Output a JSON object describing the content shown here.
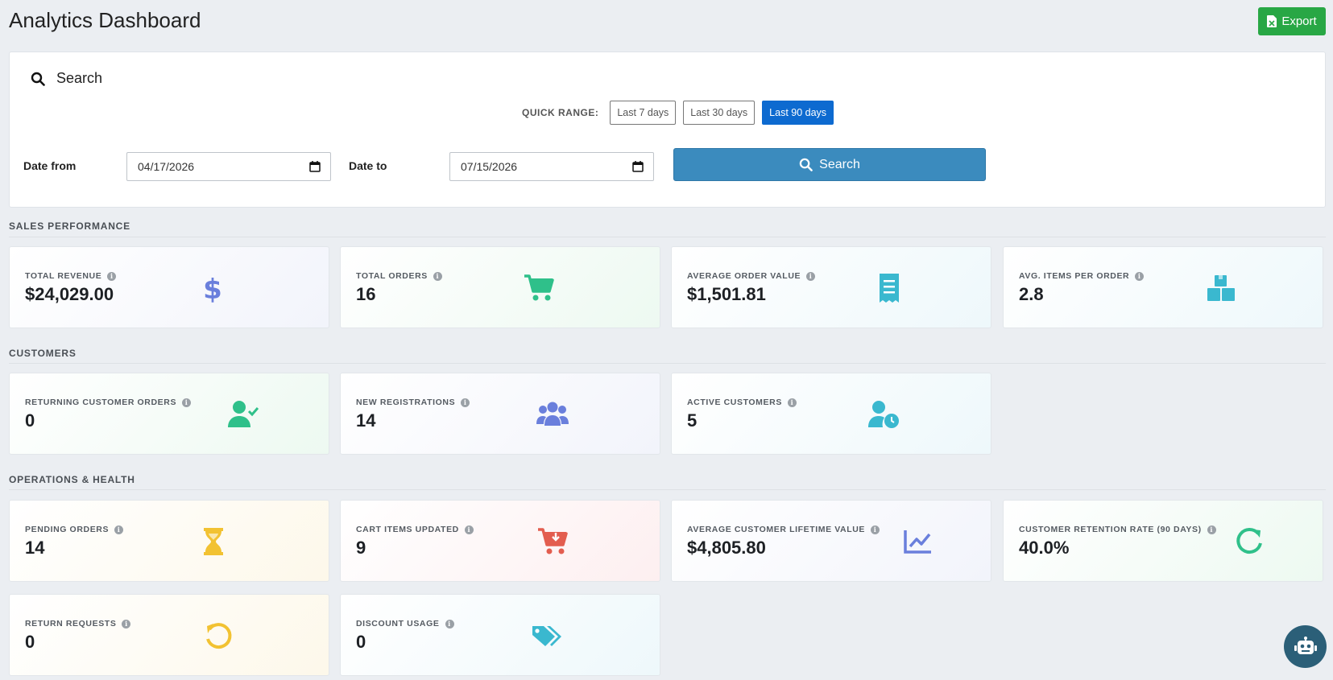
{
  "header": {
    "title": "Analytics Dashboard",
    "export_label": "Export"
  },
  "search": {
    "heading": "Search",
    "quick_range_label": "QUICK RANGE:",
    "quick_ranges": [
      "Last 7 days",
      "Last 30 days",
      "Last 90 days"
    ],
    "active_range": "Last 90 days",
    "date_from_label": "Date from",
    "date_from_value": "04/17/2026",
    "date_to_label": "Date to",
    "date_to_value": "07/15/2026",
    "search_button": "Search"
  },
  "sections": {
    "sales": {
      "title": "SALES PERFORMANCE",
      "cards": [
        {
          "label": "TOTAL REVENUE",
          "value": "$24,029.00",
          "icon": "dollar-icon",
          "color": "#6a7fdc"
        },
        {
          "label": "TOTAL ORDERS",
          "value": "16",
          "icon": "cart-icon",
          "color": "#2fc08a"
        },
        {
          "label": "AVERAGE ORDER VALUE",
          "value": "$1,501.81",
          "icon": "receipt-icon",
          "color": "#3ab8cf"
        },
        {
          "label": "AVG. ITEMS PER ORDER",
          "value": "2.8",
          "icon": "boxes-icon",
          "color": "#3ab8cf"
        }
      ]
    },
    "customers": {
      "title": "CUSTOMERS",
      "cards": [
        {
          "label": "RETURNING CUSTOMER ORDERS",
          "value": "0",
          "icon": "user-check-icon",
          "color": "#2fc08a"
        },
        {
          "label": "NEW REGISTRATIONS",
          "value": "14",
          "icon": "users-icon",
          "color": "#6a7fdc"
        },
        {
          "label": "ACTIVE CUSTOMERS",
          "value": "5",
          "icon": "user-clock-icon",
          "color": "#3ab8cf"
        }
      ]
    },
    "operations": {
      "title": "OPERATIONS & HEALTH",
      "cards": [
        {
          "label": "PENDING ORDERS",
          "value": "14",
          "icon": "hourglass-icon",
          "color": "#f2c232"
        },
        {
          "label": "CART ITEMS UPDATED",
          "value": "9",
          "icon": "cart-arrow-icon",
          "color": "#e35d4f"
        },
        {
          "label": "AVERAGE CUSTOMER LIFETIME VALUE",
          "value": "$4,805.80",
          "icon": "line-chart-icon",
          "color": "#6a7fdc"
        },
        {
          "label": "CUSTOMER RETENTION RATE (90 DAYS)",
          "value": "40.0%",
          "icon": "refresh-icon",
          "color": "#2fc08a"
        },
        {
          "label": "RETURN REQUESTS",
          "value": "0",
          "icon": "undo-icon",
          "color": "#f2c232"
        },
        {
          "label": "DISCOUNT USAGE",
          "value": "0",
          "icon": "tags-icon",
          "color": "#3ab8cf"
        }
      ]
    }
  },
  "colors": {
    "export_green": "#28a745",
    "active_range_blue": "#0d6ad0",
    "search_button_blue": "#3b8bbe",
    "bot_button": "#2b5f78"
  }
}
